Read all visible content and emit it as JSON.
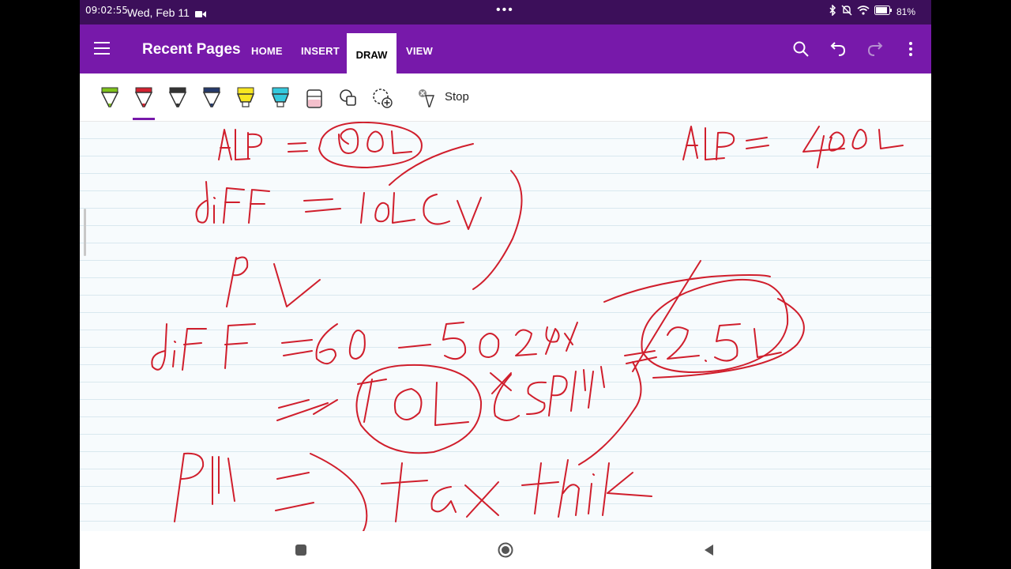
{
  "overlay": {
    "timestamp": "09:02:55"
  },
  "status_bar": {
    "date": "Wed, Feb 11",
    "battery": "81%",
    "dots": "•••"
  },
  "app_bar": {
    "title": "Recent Pages",
    "tabs": [
      {
        "label": "HOME"
      },
      {
        "label": "INSERT"
      },
      {
        "label": "DRAW"
      },
      {
        "label": "VIEW"
      }
    ],
    "active_tab": "DRAW"
  },
  "toolbar": {
    "pens": [
      {
        "name": "green-pen",
        "color": "#7fc31c"
      },
      {
        "name": "red-pen",
        "color": "#d32230"
      },
      {
        "name": "black-pen",
        "color": "#333333"
      },
      {
        "name": "navy-pen",
        "color": "#243a6b"
      },
      {
        "name": "yellow-highlighter",
        "color": "#f7e620"
      },
      {
        "name": "cyan-highlighter",
        "color": "#35c9dd"
      }
    ],
    "stop_label": "Stop"
  },
  "colors": {
    "accent": "#7719aa",
    "status_bar": "#3c0f5a",
    "ink": "#d01e2c"
  }
}
